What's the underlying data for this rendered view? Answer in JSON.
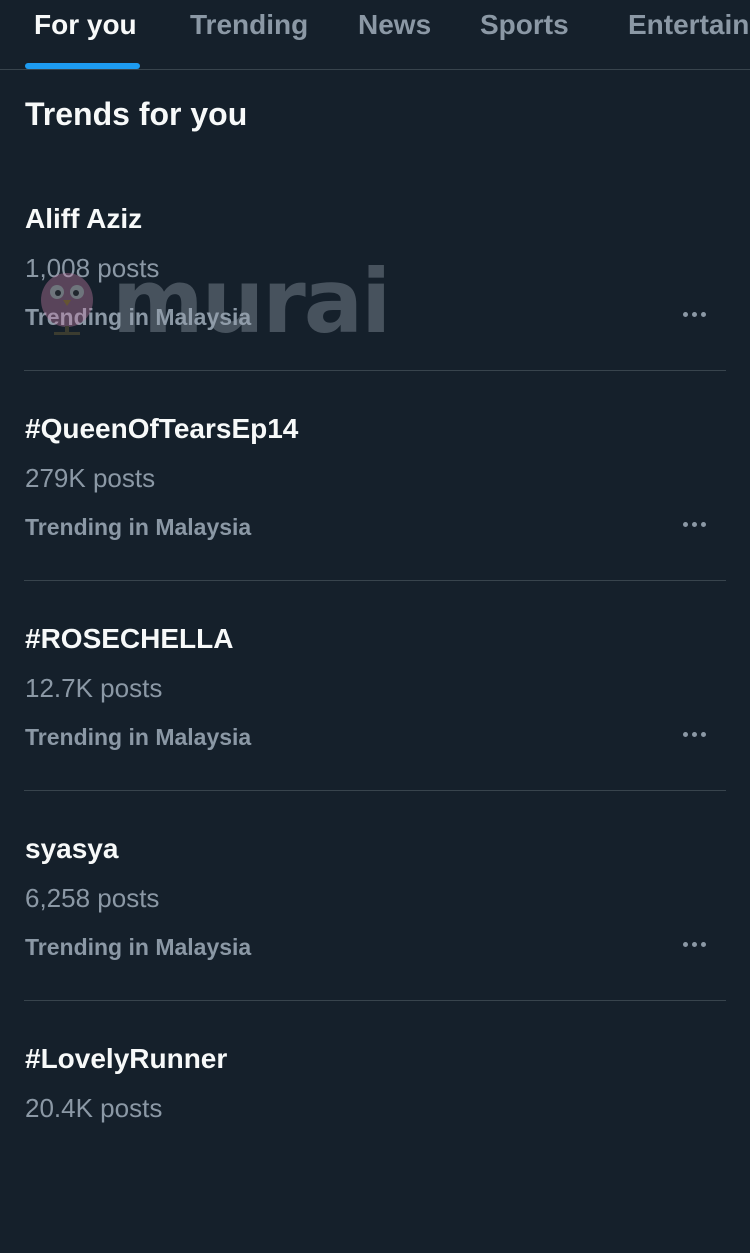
{
  "tabs": [
    {
      "label": "For you",
      "active": true
    },
    {
      "label": "Trending",
      "active": false
    },
    {
      "label": "News",
      "active": false
    },
    {
      "label": "Sports",
      "active": false
    },
    {
      "label": "Entertain",
      "active": false
    }
  ],
  "section": {
    "title": "Trends for you"
  },
  "trends": [
    {
      "name": "Aliff Aziz",
      "count": "1,008 posts",
      "context": "Trending in Malaysia"
    },
    {
      "name": "#QueenOfTearsEp14",
      "count": "279K posts",
      "context": "Trending in Malaysia"
    },
    {
      "name": "#ROSECHELLA",
      "count": "12.7K posts",
      "context": "Trending in Malaysia"
    },
    {
      "name": "syasya",
      "count": "6,258 posts",
      "context": "Trending in Malaysia"
    },
    {
      "name": "#LovelyRunner",
      "count": "20.4K posts",
      "context": ""
    }
  ],
  "watermark": {
    "text": "murai"
  },
  "colors": {
    "background": "#15202b",
    "primary_text": "#f7f9f9",
    "secondary_text": "#8b98a5",
    "accent": "#1d9bf0",
    "divider": "#38444d"
  }
}
